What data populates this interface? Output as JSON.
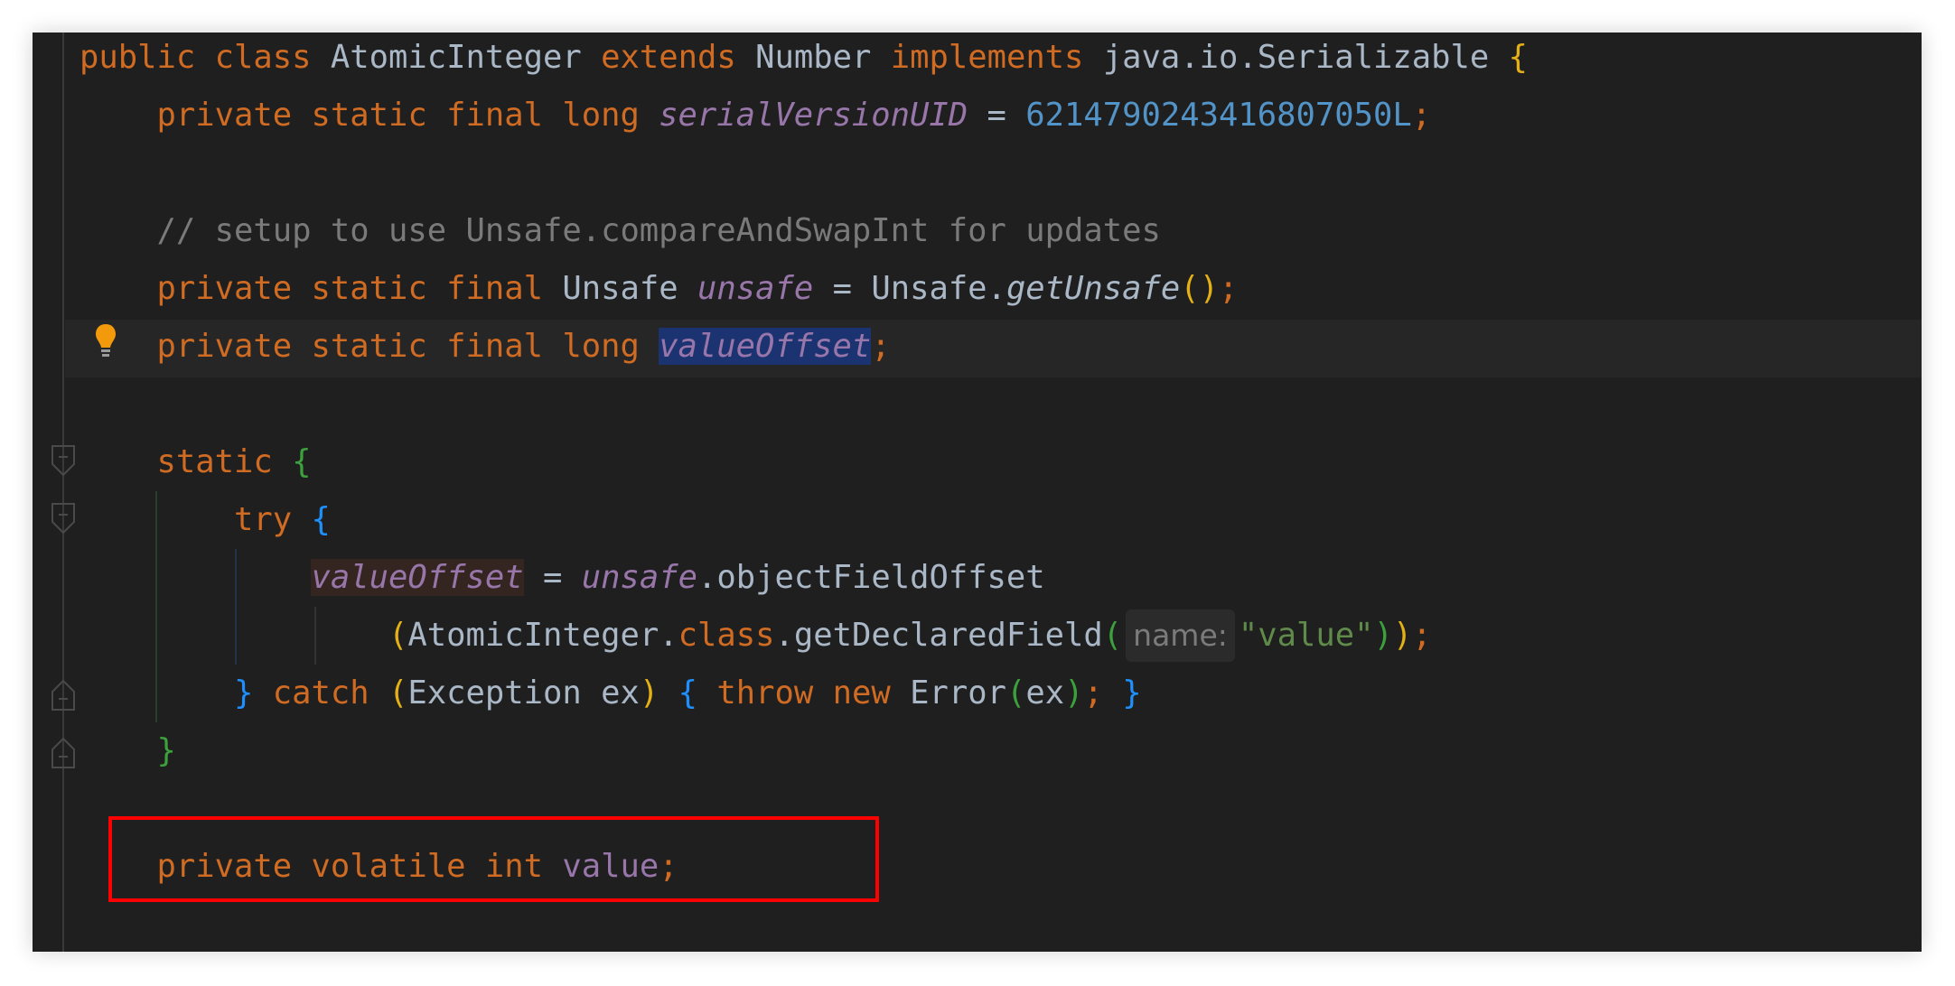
{
  "editor": {
    "language": "Java",
    "highlighted_box_note": "private volatile int value;",
    "lines": [
      {
        "id": "l1",
        "tokens": [
          {
            "t": "public class ",
            "c": "kw"
          },
          {
            "t": "AtomicInteger ",
            "c": "cls"
          },
          {
            "t": "extends ",
            "c": "kw"
          },
          {
            "t": "Number ",
            "c": "cls"
          },
          {
            "t": "implements ",
            "c": "kw"
          },
          {
            "t": "java.io.Serializable ",
            "c": "cls"
          },
          {
            "t": "{",
            "c": "br-yellow"
          }
        ]
      },
      {
        "id": "l2",
        "tokens": [
          {
            "t": "    private static final long ",
            "c": "kw"
          },
          {
            "t": "serialVersionUID",
            "c": "field"
          },
          {
            "t": " = ",
            "c": "cls"
          },
          {
            "t": "6214790243416807050L",
            "c": "num"
          },
          {
            "t": ";",
            "c": "semi"
          }
        ]
      },
      {
        "id": "l3",
        "tokens": []
      },
      {
        "id": "l4",
        "tokens": [
          {
            "t": "    // setup to use Unsafe.compareAndSwapInt for updates",
            "c": "cm"
          }
        ]
      },
      {
        "id": "l5",
        "tokens": [
          {
            "t": "    private static final ",
            "c": "kw"
          },
          {
            "t": "Unsafe ",
            "c": "cls"
          },
          {
            "t": "unsafe",
            "c": "field"
          },
          {
            "t": " = Unsafe.",
            "c": "cls"
          },
          {
            "t": "getUnsafe",
            "c": "method-it"
          },
          {
            "t": "()",
            "c": "br-yellow"
          },
          {
            "t": ";",
            "c": "semi"
          }
        ]
      },
      {
        "id": "l6",
        "tokens": [
          {
            "t": "    private static final long ",
            "c": "kw"
          },
          {
            "t": "valueOffset",
            "c": "field sel"
          },
          {
            "t": ";",
            "c": "semi"
          }
        ]
      },
      {
        "id": "l7",
        "tokens": []
      },
      {
        "id": "l8",
        "tokens": [
          {
            "t": "    static ",
            "c": "kw"
          },
          {
            "t": "{",
            "c": "br-green"
          }
        ]
      },
      {
        "id": "l9",
        "tokens": [
          {
            "t": "        try ",
            "c": "kw"
          },
          {
            "t": "{",
            "c": "br-blue"
          }
        ]
      },
      {
        "id": "l10",
        "tokens": [
          {
            "t": "            ",
            "c": "cls"
          },
          {
            "t": "valueOffset",
            "c": "field write-hl"
          },
          {
            "t": " = ",
            "c": "cls"
          },
          {
            "t": "unsafe",
            "c": "field"
          },
          {
            "t": ".objectFieldOffset",
            "c": "cls"
          }
        ]
      },
      {
        "id": "l11",
        "tokens": [
          {
            "t": "                ",
            "c": "cls"
          },
          {
            "t": "(",
            "c": "br-yellow"
          },
          {
            "t": "AtomicInteger.",
            "c": "cls"
          },
          {
            "t": "class",
            "c": "kw"
          },
          {
            "t": ".getDeclaredField",
            "c": "cls"
          },
          {
            "t": "(",
            "c": "br-green"
          },
          {
            "t": "name:",
            "c": "inlay"
          },
          {
            "t": "\"value\"",
            "c": "str"
          },
          {
            "t": ")",
            "c": "br-green"
          },
          {
            "t": ")",
            "c": "br-yellow"
          },
          {
            "t": ";",
            "c": "semi"
          }
        ]
      },
      {
        "id": "l12",
        "tokens": [
          {
            "t": "        ",
            "c": "cls"
          },
          {
            "t": "}",
            "c": "br-blue"
          },
          {
            "t": " catch ",
            "c": "kw"
          },
          {
            "t": "(",
            "c": "br-yellow"
          },
          {
            "t": "Exception ex",
            "c": "cls"
          },
          {
            "t": ")",
            "c": "br-yellow"
          },
          {
            "t": " ",
            "c": "cls"
          },
          {
            "t": "{",
            "c": "br-blue"
          },
          {
            "t": " throw new ",
            "c": "kw"
          },
          {
            "t": "Error",
            "c": "cls"
          },
          {
            "t": "(",
            "c": "br-green"
          },
          {
            "t": "ex",
            "c": "cls"
          },
          {
            "t": ")",
            "c": "br-green"
          },
          {
            "t": "; ",
            "c": "semi"
          },
          {
            "t": "}",
            "c": "br-blue"
          }
        ]
      },
      {
        "id": "l13",
        "tokens": [
          {
            "t": "    ",
            "c": "cls"
          },
          {
            "t": "}",
            "c": "br-green"
          }
        ]
      },
      {
        "id": "l14",
        "tokens": []
      },
      {
        "id": "l15",
        "tokens": [
          {
            "t": "    private volatile int ",
            "c": "kw"
          },
          {
            "t": "value",
            "c": "field-plain"
          },
          {
            "t": ";",
            "c": "semi"
          }
        ]
      }
    ]
  },
  "gutter": {
    "intention_icon": "lightbulb-icon",
    "fold_icons": [
      "fold-start-icon",
      "fold-start-icon",
      "fold-end-icon",
      "fold-end-icon"
    ]
  },
  "colors": {
    "background": "#1f1f1f",
    "keyword": "#cf6b23",
    "field": "#9876aa",
    "number": "#5394c8",
    "string": "#5f8a4a",
    "comment": "#7a7a7a",
    "selection": "#1b3370",
    "annotation_box": "#ff0000"
  }
}
